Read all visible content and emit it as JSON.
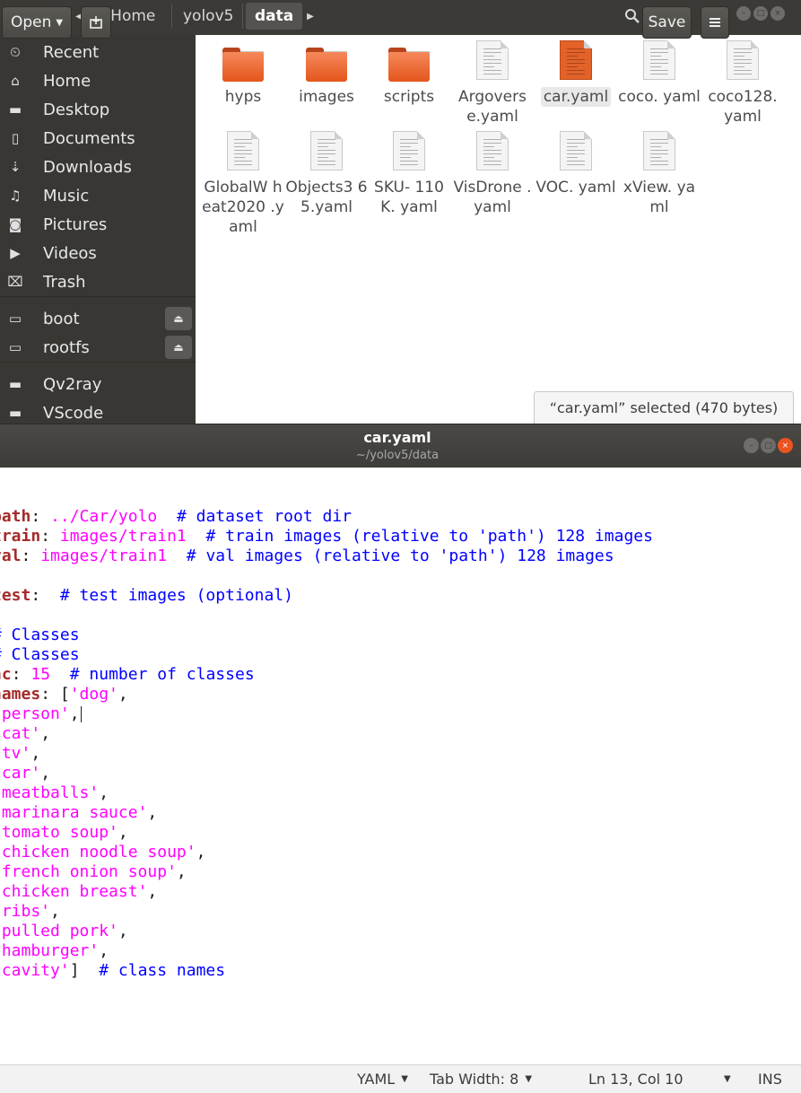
{
  "file_manager": {
    "breadcrumbs": [
      "Home",
      "yolov5",
      "data"
    ],
    "sidebar": [
      {
        "icon": "clock-icon",
        "glyph": "⏲",
        "label": "Recent"
      },
      {
        "icon": "home-icon",
        "glyph": "⌂",
        "label": "Home"
      },
      {
        "icon": "folder-icon",
        "glyph": "▬",
        "label": "Desktop"
      },
      {
        "icon": "document-icon",
        "glyph": "▯",
        "label": "Documents"
      },
      {
        "icon": "download-icon",
        "glyph": "⇣",
        "label": "Downloads"
      },
      {
        "icon": "music-icon",
        "glyph": "♫",
        "label": "Music"
      },
      {
        "icon": "camera-icon",
        "glyph": "◙",
        "label": "Pictures"
      },
      {
        "icon": "video-icon",
        "glyph": "▶",
        "label": "Videos"
      },
      {
        "icon": "trash-icon",
        "glyph": "⌧",
        "label": "Trash"
      },
      {
        "icon": "drive-icon",
        "glyph": "▭",
        "label": "boot"
      },
      {
        "icon": "drive-icon",
        "glyph": "▭",
        "label": "rootfs"
      },
      {
        "icon": "folder-icon",
        "glyph": "▬",
        "label": "Qv2ray"
      },
      {
        "icon": "folder-icon",
        "glyph": "▬",
        "label": "VScode"
      }
    ],
    "files": [
      {
        "type": "folder",
        "name": "hyps"
      },
      {
        "type": "folder",
        "name": "images"
      },
      {
        "type": "folder",
        "name": "scripts"
      },
      {
        "type": "file",
        "name": "Argoverse.yaml",
        "label": "Argovers e.yaml"
      },
      {
        "type": "file-selected",
        "name": "car.yaml",
        "label": "car.yaml"
      },
      {
        "type": "file",
        "name": "coco.yaml",
        "label": "coco. yaml"
      },
      {
        "type": "file",
        "name": "coco128.yaml",
        "label": "coco128. yaml"
      },
      {
        "type": "file",
        "name": "GlobalWheat2020.yaml",
        "label": "GlobalW heat2020 .yaml"
      },
      {
        "type": "file",
        "name": "Objects365.yaml",
        "label": "Objects3 65.yaml"
      },
      {
        "type": "file",
        "name": "SKU-110K.yaml",
        "label": "SKU- 110K. yaml"
      },
      {
        "type": "file",
        "name": "VisDrone.yaml",
        "label": "VisDrone .yaml"
      },
      {
        "type": "file",
        "name": "VOC.yaml",
        "label": "VOC. yaml"
      },
      {
        "type": "file",
        "name": "xView.yaml",
        "label": "xView. yaml"
      }
    ],
    "status": "“car.yaml” selected (470 bytes)"
  },
  "editor": {
    "open_label": "Open",
    "save_label": "Save",
    "title": "car.yaml",
    "subtitle": "~/yolov5/data",
    "lines": [
      [
        [
          "k",
          "path"
        ],
        [
          "p",
          ": "
        ],
        [
          "v",
          "../Car/yolo"
        ],
        [
          "p",
          "  "
        ],
        [
          "c",
          "# dataset root dir"
        ]
      ],
      [
        [
          "k",
          "train"
        ],
        [
          "p",
          ": "
        ],
        [
          "v",
          "images/train1"
        ],
        [
          "p",
          "  "
        ],
        [
          "c",
          "# train images (relative to 'path') 128 images"
        ]
      ],
      [
        [
          "k",
          "val"
        ],
        [
          "p",
          ": "
        ],
        [
          "v",
          "images/train1"
        ],
        [
          "p",
          "  "
        ],
        [
          "c",
          "# val images (relative to 'path') 128 images"
        ]
      ],
      [],
      [
        [
          "k",
          "test"
        ],
        [
          "p",
          ":  "
        ],
        [
          "c",
          "# test images (optional)"
        ]
      ],
      [],
      [
        [
          "c",
          "# Classes"
        ]
      ],
      [
        [
          "c",
          "# Classes"
        ]
      ],
      [
        [
          "k",
          "nc"
        ],
        [
          "p",
          ": "
        ],
        [
          "v",
          "15"
        ],
        [
          "p",
          "  "
        ],
        [
          "c",
          "# number of classes"
        ]
      ],
      [
        [
          "k",
          "names"
        ],
        [
          "p",
          ": ["
        ],
        [
          "s",
          "'dog'"
        ],
        [
          "p",
          ","
        ]
      ],
      [
        [
          "s",
          "'person'"
        ],
        [
          "p",
          ","
        ],
        [
          "cursor",
          ""
        ]
      ],
      [
        [
          "s",
          "'cat'"
        ],
        [
          "p",
          ","
        ]
      ],
      [
        [
          "s",
          "'tv'"
        ],
        [
          "p",
          ","
        ]
      ],
      [
        [
          "s",
          "'car'"
        ],
        [
          "p",
          ","
        ]
      ],
      [
        [
          "s",
          "'meatballs'"
        ],
        [
          "p",
          ","
        ]
      ],
      [
        [
          "s",
          "'marinara sauce'"
        ],
        [
          "p",
          ","
        ]
      ],
      [
        [
          "s",
          "'tomato soup'"
        ],
        [
          "p",
          ","
        ]
      ],
      [
        [
          "s",
          "'chicken noodle soup'"
        ],
        [
          "p",
          ","
        ]
      ],
      [
        [
          "s",
          "'french onion soup'"
        ],
        [
          "p",
          ","
        ]
      ],
      [
        [
          "s",
          "'chicken breast'"
        ],
        [
          "p",
          ","
        ]
      ],
      [
        [
          "s",
          "'ribs'"
        ],
        [
          "p",
          ","
        ]
      ],
      [
        [
          "s",
          "'pulled pork'"
        ],
        [
          "p",
          ","
        ]
      ],
      [
        [
          "s",
          "'hamburger'"
        ],
        [
          "p",
          ","
        ]
      ],
      [
        [
          "s",
          "'cavity'"
        ],
        [
          "p",
          "]  "
        ],
        [
          "c",
          "# class names"
        ]
      ]
    ],
    "status": {
      "language": "YAML",
      "tab_width": "Tab Width: 8",
      "position": "Ln 13, Col 10",
      "mode": "INS"
    }
  }
}
